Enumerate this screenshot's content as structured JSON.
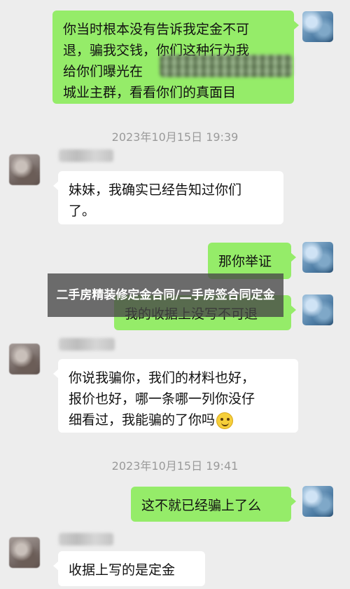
{
  "messages": [
    {
      "id": "m1",
      "side": "right",
      "text_lines": [
        "你当时根本没有告诉我定金不可",
        "退，骗我交钱，你们这种行为我",
        "给你们曝光在",
        "城业主群，看看你们的真面目"
      ]
    },
    {
      "id": "ts1",
      "type": "timestamp",
      "text": "2023年10月15日 19:39"
    },
    {
      "id": "m2",
      "side": "left",
      "text_lines": [
        "妹妹，我确实已经告知过你们",
        "了。"
      ]
    },
    {
      "id": "m3",
      "side": "right",
      "text": "那你举证"
    },
    {
      "id": "m4",
      "side": "right",
      "text": "我的收据上没写不可退"
    },
    {
      "id": "m5",
      "side": "left",
      "text_lines": [
        "你说我骗你，我们的材料也好，",
        "报价也好，哪一条哪一列你没仔",
        "细看过，我能骗的了你吗"
      ],
      "emoji": "smile-emoji"
    },
    {
      "id": "ts2",
      "type": "timestamp",
      "text": "2023年10月15日 19:41"
    },
    {
      "id": "m6",
      "side": "right",
      "text": "这不就已经骗上了么"
    },
    {
      "id": "m7",
      "side": "left",
      "text": "收据上写的是定金"
    }
  ],
  "banner": {
    "text": "二手房精装修定金合同/二手房签合同定金"
  },
  "colors": {
    "background": "#ededed",
    "sent_bubble": "#95ec69",
    "received_bubble": "#ffffff",
    "timestamp": "#9a9a9a"
  }
}
